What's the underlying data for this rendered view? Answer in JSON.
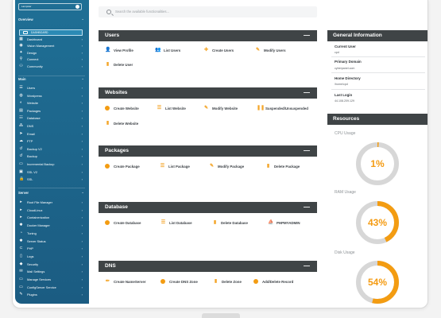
{
  "sidebar": {
    "brand_text": "Lampster",
    "overview_label": "Overview",
    "dashboard_label": "DASHBOARD",
    "overview_items": [
      {
        "icon": "dashboard-icon",
        "label": "Dashboard"
      },
      {
        "icon": "vision-icon",
        "label": "Vision Management"
      },
      {
        "icon": "design-icon",
        "label": "Design"
      },
      {
        "icon": "connect-icon",
        "label": "Connect"
      },
      {
        "icon": "community-icon",
        "label": "Community"
      }
    ],
    "main_label": "Main",
    "main_items": [
      {
        "icon": "users-icon",
        "label": "Users"
      },
      {
        "icon": "wordpress-icon",
        "label": "Wordpress"
      },
      {
        "icon": "website-icon",
        "label": "Website"
      },
      {
        "icon": "packages-icon",
        "label": "Packages"
      },
      {
        "icon": "database-icon",
        "label": "Database"
      },
      {
        "icon": "dns-icon",
        "label": "DNS"
      },
      {
        "icon": "email-icon",
        "label": "Email"
      },
      {
        "icon": "ftp-icon",
        "label": "FTP"
      },
      {
        "icon": "backup-icon",
        "label": "Backup V2"
      },
      {
        "icon": "backup-icon",
        "label": "Backup"
      },
      {
        "icon": "incremental-backup-icon",
        "label": "Incremental Backup"
      },
      {
        "icon": "ssl-icon",
        "label": "SSL V2"
      },
      {
        "icon": "lock-icon",
        "label": "SSL"
      }
    ],
    "server_label": "Server",
    "server_items": [
      {
        "icon": "root-file-manager-icon",
        "label": "Root File Manager"
      },
      {
        "icon": "cloudlinux-icon",
        "label": "CloudLinux"
      },
      {
        "icon": "containerization-icon",
        "label": "Containerization"
      },
      {
        "icon": "docker-icon",
        "label": "Docker Manager"
      },
      {
        "icon": "tuning-icon",
        "label": "Tuning"
      },
      {
        "icon": "server-status-icon",
        "label": "Server Status"
      },
      {
        "icon": "php-icon",
        "label": "PHP"
      },
      {
        "icon": "logs-icon",
        "label": "Logs"
      },
      {
        "icon": "security-icon",
        "label": "Security"
      },
      {
        "icon": "mail-settings-icon",
        "label": "Mail Settings"
      },
      {
        "icon": "manage-services-icon",
        "label": "Manage Services"
      },
      {
        "icon": "configserver-icon",
        "label": "ConfigServer Service"
      },
      {
        "icon": "plugins-icon",
        "label": "Plugins"
      }
    ]
  },
  "search": {
    "placeholder": "Search the available functionalities..."
  },
  "panels": {
    "users": {
      "title": "Users",
      "actions": [
        "View Profile",
        "List Users",
        "Create Users",
        "Modify Users",
        "Delete User"
      ]
    },
    "websites": {
      "title": "Websites",
      "actions": [
        "Create Website",
        "List Website",
        "Modify Website",
        "Suspended/Unsuspended",
        "Delete Website"
      ]
    },
    "packages": {
      "title": "Packages",
      "actions": [
        "Create Package",
        "List Package",
        "Modify Package",
        "Delete Package"
      ]
    },
    "database": {
      "title": "Database",
      "actions": [
        "Create Database",
        "List Database",
        "Delete Database",
        "PHPMYADMIN"
      ]
    },
    "dns": {
      "title": "DNS",
      "actions": [
        "Create NameServer",
        "Create DNS Zone",
        "Delete Zone",
        "Add/Delete Record"
      ]
    },
    "minimize_symbol": "—"
  },
  "general_info": {
    "title": "General Information",
    "current_user_label": "Current User",
    "current_user_value": "cpd",
    "primary_domain_label": "Primary Domain",
    "primary_domain_value": "cyberpanel.com",
    "home_dir_label": "Home Directory",
    "home_dir_value": "/home/cpd",
    "last_login_label": "Last Login",
    "last_login_value": "44.108.209.129"
  },
  "resources": {
    "title": "Resources",
    "cpu_label": "CPU Usage",
    "cpu_value": "1%",
    "cpu_fraction": 0.01,
    "ram_label": "RAM Usage",
    "ram_value": "43%",
    "ram_fraction": 0.43,
    "disk_label": "Disk Usage",
    "disk_value": "54%",
    "disk_fraction": 0.54
  },
  "colors": {
    "accent": "#f39c12",
    "panel_header": "#3f4446",
    "sidebar": "#1f6f95"
  }
}
